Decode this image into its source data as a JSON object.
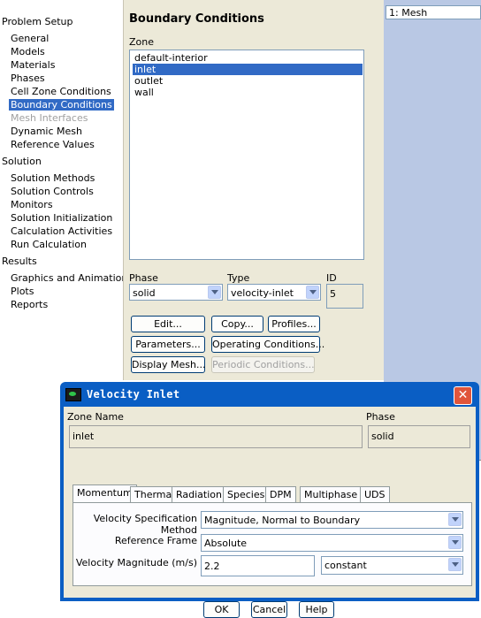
{
  "tree": {
    "sections": [
      {
        "label": "Problem Setup",
        "items": [
          "General",
          "Models",
          "Materials",
          "Phases",
          "Cell Zone Conditions",
          "Boundary Conditions",
          "Mesh Interfaces",
          "Dynamic Mesh",
          "Reference Values"
        ]
      },
      {
        "label": "Solution",
        "items": [
          "Solution Methods",
          "Solution Controls",
          "Monitors",
          "Solution Initialization",
          "Calculation Activities",
          "Run Calculation"
        ]
      },
      {
        "label": "Results",
        "items": [
          "Graphics and Animations",
          "Plots",
          "Reports"
        ]
      }
    ],
    "selected": "Boundary Conditions",
    "disabled": "Mesh Interfaces"
  },
  "panel": {
    "title": "Boundary Conditions",
    "zone_label": "Zone",
    "zones": [
      "default-interior",
      "inlet",
      "outlet",
      "wall"
    ],
    "selected_zone": "inlet",
    "phase_label": "Phase",
    "phase_value": "solid",
    "type_label": "Type",
    "type_value": "velocity-inlet",
    "id_label": "ID",
    "id_value": "5",
    "buttons": {
      "edit": "Edit...",
      "copy": "Copy...",
      "profiles": "Profiles...",
      "parameters": "Parameters...",
      "operating": "Operating Conditions...",
      "display_mesh": "Display Mesh...",
      "periodic": "Periodic Conditions..."
    }
  },
  "graphics": {
    "tab_label": "1: Mesh"
  },
  "dialog": {
    "title": "Velocity Inlet",
    "zone_name_label": "Zone Name",
    "zone_name_value": "inlet",
    "phase_label": "Phase",
    "phase_value": "solid",
    "tabs": [
      "Momentum",
      "Thermal",
      "Radiation",
      "Species",
      "DPM",
      "Multiphase",
      "UDS"
    ],
    "active_tab": "Momentum",
    "velocity_spec_label": "Velocity Specification Method",
    "velocity_spec_value": "Magnitude, Normal to Boundary",
    "reference_frame_label": "Reference Frame",
    "reference_frame_value": "Absolute",
    "velocity_mag_label": "Velocity Magnitude (m/s)",
    "velocity_mag_value": "2.2",
    "velocity_mag_method": "constant",
    "ok": "OK",
    "cancel": "Cancel",
    "help": "Help"
  }
}
